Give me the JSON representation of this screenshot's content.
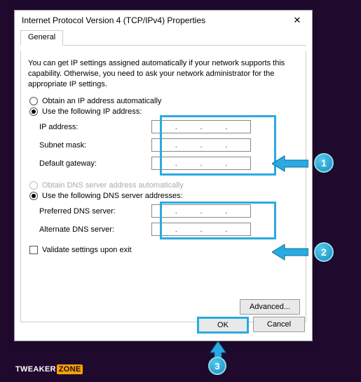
{
  "dialog": {
    "title": "Internet Protocol Version 4 (TCP/IPv4) Properties",
    "tab": "General",
    "description": "You can get IP settings assigned automatically if your network supports this capability. Otherwise, you need to ask your network administrator for the appropriate IP settings.",
    "radio_auto_ip": "Obtain an IP address automatically",
    "radio_manual_ip": "Use the following IP address:",
    "fields_ip": {
      "ip_address": "IP address:",
      "subnet_mask": "Subnet mask:",
      "default_gateway": "Default gateway:"
    },
    "radio_auto_dns": "Obtain DNS server address automatically",
    "radio_manual_dns": "Use the following DNS server addresses:",
    "fields_dns": {
      "preferred": "Preferred DNS server:",
      "alternate": "Alternate DNS server:"
    },
    "checkbox_validate": "Validate settings upon exit",
    "btn_advanced": "Advanced...",
    "btn_ok": "OK",
    "btn_cancel": "Cancel"
  },
  "annotations": {
    "badge1": "1",
    "badge2": "2",
    "badge3": "3"
  },
  "watermark": {
    "part1": "TWEAKER",
    "part2": "ZONE"
  }
}
